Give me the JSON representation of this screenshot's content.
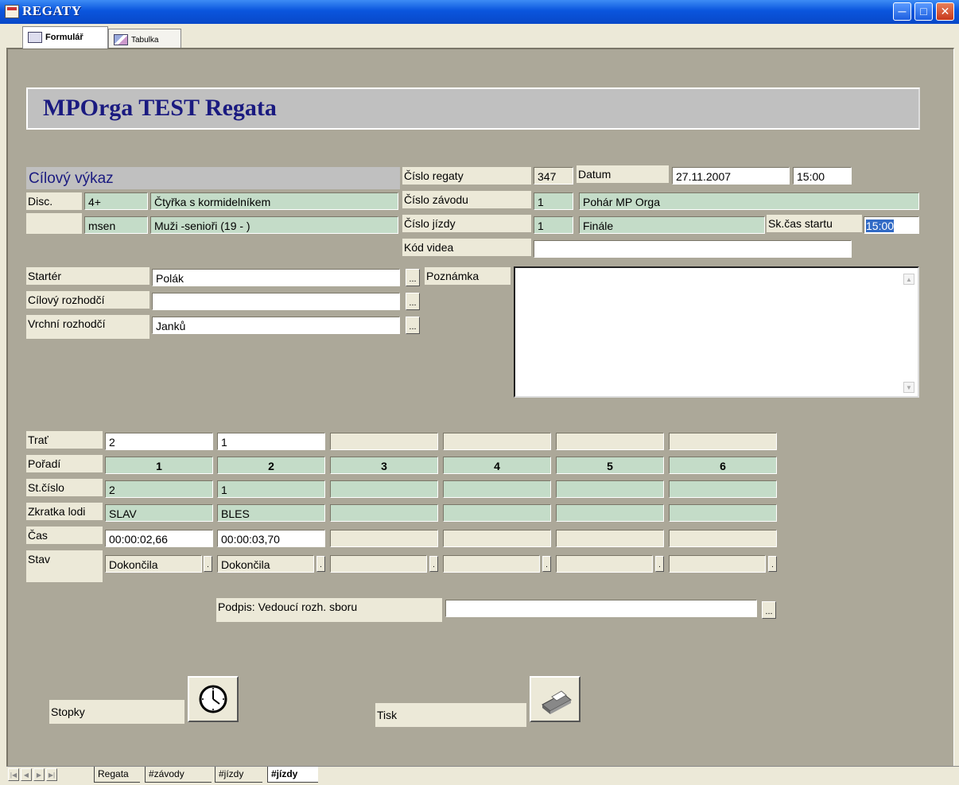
{
  "window": {
    "title": "REGATY",
    "buttons": [
      "minimize",
      "maximize",
      "close"
    ]
  },
  "tabs": [
    {
      "label": "Formulář",
      "active": true,
      "icon": "form-icon"
    },
    {
      "label": "Tabulka",
      "active": false,
      "icon": "table-icon"
    }
  ],
  "header": {
    "title": "MPOrga TEST Regata"
  },
  "section_title": "Cílový výkaz",
  "disc": {
    "label": "Disc.",
    "code1": "4+",
    "name1": "Čtyřka s kormidelníkem",
    "code2": "msen",
    "name2": "Muži -senioři (19 - )"
  },
  "regatta": {
    "cislo_regaty_label": "Číslo regaty",
    "cislo_regaty": "347",
    "datum_label": "Datum",
    "datum": "27.11.2007",
    "cas": "15:00",
    "cislo_zavodu_label": "Číslo závodu",
    "cislo_zavodu": "1",
    "nazev_zavodu": "Pohár MP Orga",
    "cislo_jizdy_label": "Číslo jízdy",
    "cislo_jizdy": "1",
    "nazev_jizdy": "Finále",
    "skcas_label": "Sk.čas startu",
    "skcas": "15:00",
    "kod_videa_label": "Kód videa",
    "kod_videa": ""
  },
  "officials": {
    "starter_label": "Startér",
    "starter": "Polák",
    "cilovy_label": "Cílový rozhodčí",
    "cilovy": "",
    "vrchni_label": "Vrchní rozhodčí",
    "vrchni": "Janků",
    "poznamka_label": "Poznámka",
    "poznamka": ""
  },
  "results": {
    "row_labels": {
      "trat": "Trať",
      "poradi": "Pořadí",
      "stcislo": "St.číslo",
      "zkratka": "Zkratka lodi",
      "cas": "Čas",
      "stav": "Stav"
    },
    "columns": [
      {
        "trat": "2",
        "poradi": "1",
        "stcislo": "2",
        "zkratka": "SLAV",
        "cas": "00:00:02,66",
        "stav": "Dokončila"
      },
      {
        "trat": "1",
        "poradi": "2",
        "stcislo": "1",
        "zkratka": "BLES",
        "cas": "00:00:03,70",
        "stav": "Dokončila"
      },
      {
        "trat": "",
        "poradi": "3",
        "stcislo": "",
        "zkratka": "",
        "cas": "",
        "stav": ""
      },
      {
        "trat": "",
        "poradi": "4",
        "stcislo": "",
        "zkratka": "",
        "cas": "",
        "stav": ""
      },
      {
        "trat": "",
        "poradi": "5",
        "stcislo": "",
        "zkratka": "",
        "cas": "",
        "stav": ""
      },
      {
        "trat": "",
        "poradi": "6",
        "stcislo": "",
        "zkratka": "",
        "cas": "",
        "stav": ""
      }
    ]
  },
  "signature": {
    "label": "Podpis: Vedoucí rozh. sboru",
    "value": ""
  },
  "buttons": {
    "stopky": "Stopky",
    "tisk": "Tisk",
    "ellipsis": "...",
    "dropdown": "."
  },
  "sheet_tabs": [
    {
      "label": "Regata",
      "active": false
    },
    {
      "label": "#závody",
      "active": false
    },
    {
      "label": "#jízdy",
      "active": false
    },
    {
      "label": "#jízdy",
      "active": true
    }
  ],
  "colors": {
    "field_green": "#c4dcc8",
    "form_bg": "#aca899",
    "header_text": "#1a1a80",
    "titlebar": "#0a55dd"
  }
}
